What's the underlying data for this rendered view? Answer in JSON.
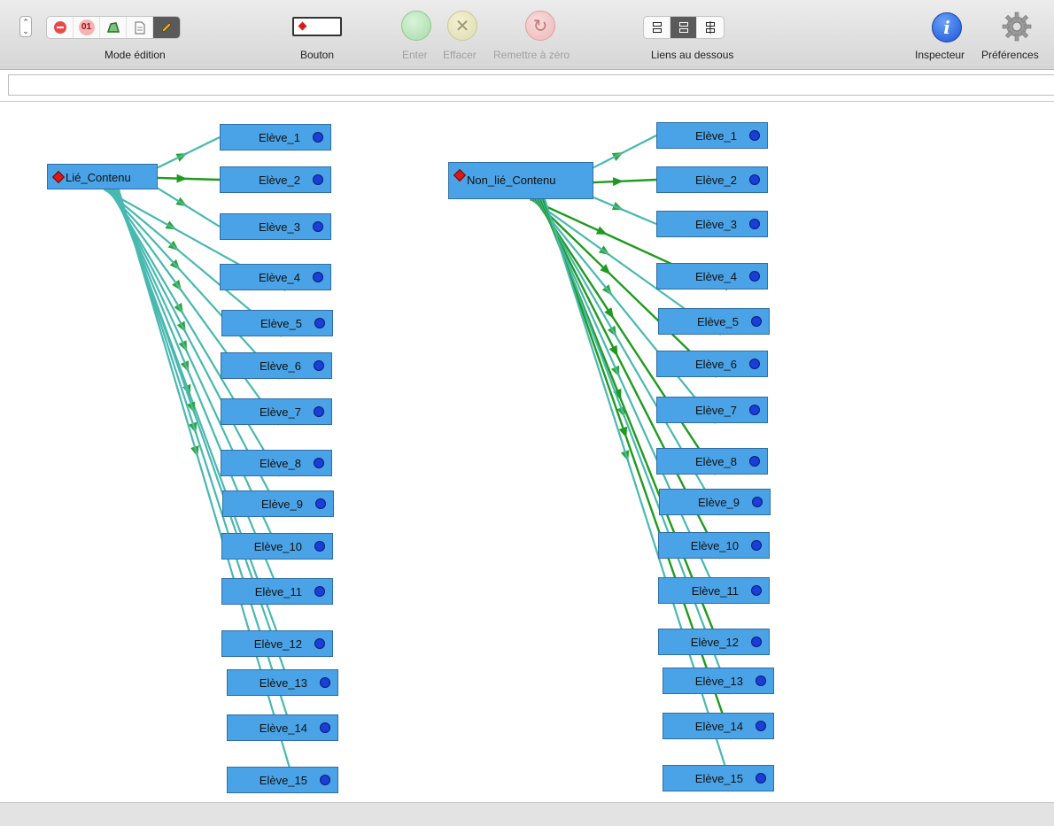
{
  "toolbar": {
    "mode_label": "Mode édition",
    "bouton_label": "Bouton",
    "enter_label": "Enter",
    "effacer_label": "Effacer",
    "remettre_label": "Remettre à zéro",
    "liens_label": "Liens au dessous",
    "inspecteur_label": "Inspecteur",
    "preferences_label": "Préférences",
    "mode_icons": [
      "stop-icon",
      "binary-icon",
      "shape-icon",
      "document-icon",
      "pencil-icon"
    ],
    "tool_01_text": "01",
    "layout_icons": [
      "layout-below-icon",
      "layout-center-icon",
      "layout-tree-icon"
    ],
    "active_mode": "pencil-icon",
    "active_layout": "layout-center-icon"
  },
  "url_bar": {
    "value": ""
  },
  "graphs": [
    {
      "parent_label": "Lié_Contenu",
      "children": [
        "Elève_1",
        "Elève_2",
        "Elève_3",
        "Elève_4",
        "Elève_5",
        "Elève_6",
        "Elève_7",
        "Elève_8",
        "Elève_9",
        "Elève_10",
        "Elève_11",
        "Elève_12",
        "Elève_13",
        "Elève_14",
        "Elève_15"
      ]
    },
    {
      "parent_label": "Non_lié_Contenu",
      "children": [
        "Elève_1",
        "Elève_2",
        "Elève_3",
        "Elève_4",
        "Elève_5",
        "Elève_6",
        "Elève_7",
        "Elève_8",
        "Elève_9",
        "Elève_10",
        "Elève_11",
        "Elève_12",
        "Elève_13",
        "Elève_14",
        "Elève_15"
      ]
    }
  ],
  "colors": {
    "node_fill": "#4aa3e6",
    "link_teal": "#48b8b0",
    "link_green": "#1f9a1f",
    "dot_blue": "#1a3fd6",
    "diamond_red": "#d81a1a"
  }
}
